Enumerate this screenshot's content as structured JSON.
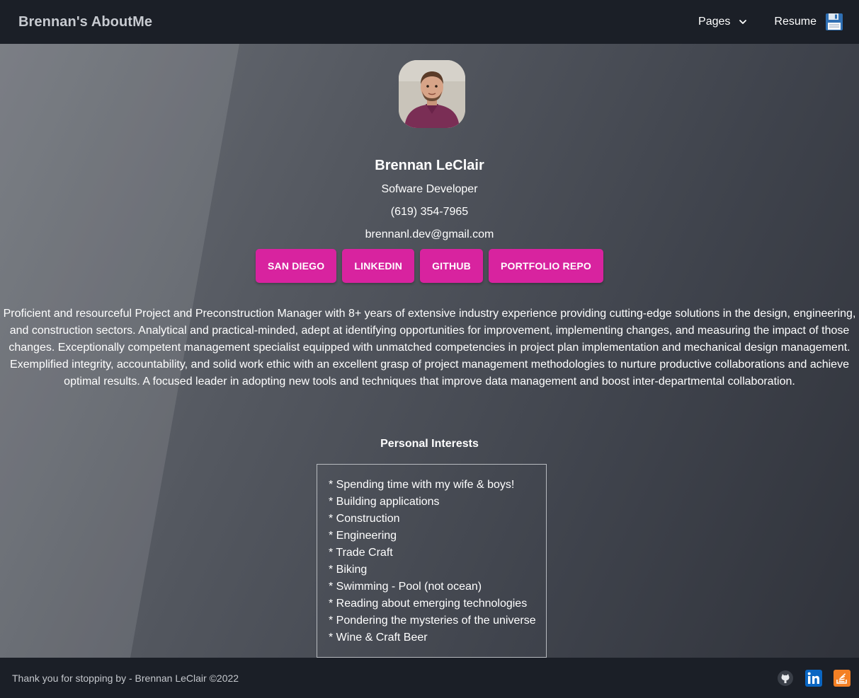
{
  "navbar": {
    "brand": "Brennan's AboutMe",
    "pages_label": "Pages",
    "resume_label": "Resume"
  },
  "profile": {
    "name": "Brennan LeClair",
    "role": "Sofware Developer",
    "phone": "(619) 354-7965",
    "email": "brennanl.dev@gmail.com"
  },
  "buttons": [
    "SAN DIEGO",
    "LINKEDIN",
    "GITHUB",
    "PORTFOLIO REPO"
  ],
  "bio": "Proficient and resourceful Project and Preconstruction Manager with 8+ years of extensive industry experience providing cutting-edge solutions in the design, engineering, and construction sectors. Analytical and practical-minded, adept at identifying opportunities for improvement, implementing changes, and measuring the impact of those changes. Exceptionally competent management specialist equipped with unmatched competencies in project plan implementation and mechanical design management. Exemplified integrity, accountability, and solid work ethic with an excellent grasp of project management methodologies to nurture productive collaborations and achieve optimal results. A focused leader in adopting new tools and techniques that improve data management and boost inter-departmental collaboration.",
  "interests": {
    "title": "Personal Interests",
    "items": [
      "* Spending time with my wife & boys!",
      "* Building applications",
      "* Construction",
      "* Engineering",
      "* Trade Craft",
      "* Biking",
      "* Swimming - Pool (not ocean)",
      "* Reading about emerging technologies",
      "* Pondering the mysteries of the universe",
      "* Wine & Craft Beer"
    ]
  },
  "footer": {
    "text": "Thank you for stopping by - Brennan LeClair ©2022",
    "icons": [
      "github-icon",
      "linkedin-icon",
      "stackoverflow-icon"
    ]
  },
  "colors": {
    "accent": "#d8239f",
    "navbar_bg": "#1b1f27",
    "linkedin": "#0a66c2",
    "stackoverflow": "#f48024"
  }
}
